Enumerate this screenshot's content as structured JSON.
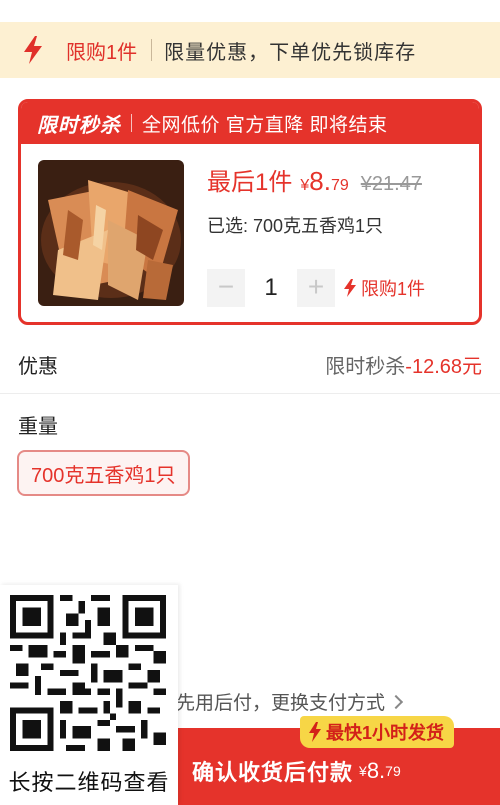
{
  "notice": {
    "limit_label": "限购1件",
    "text": "限量优惠，下单优先锁库存"
  },
  "flash_sale": {
    "title": "限时秒杀",
    "slogan": "全网低价 官方直降 即将结束",
    "last_one": "最后1件",
    "currency": "¥",
    "price_int": "8.",
    "price_dec": "79",
    "original_price": "¥21.47",
    "selected_text": "已选: 700克五香鸡1只",
    "quantity": "1",
    "minus_label": "−",
    "plus_label": "+",
    "limit_text": "限购1件"
  },
  "discount": {
    "label": "优惠",
    "name": "限时秒杀",
    "amount": "-12.68元"
  },
  "weight": {
    "label": "重量",
    "option": "700克五香鸡1只"
  },
  "payment": {
    "method_text": "先用后付，更换支付方式"
  },
  "confirm": {
    "label": "确认收货后付款",
    "currency": "¥",
    "price_int": "8.",
    "price_dec": "79"
  },
  "shipping_badge": "最快1小时发货",
  "qr": {
    "caption": "长按二维码查看"
  },
  "colors": {
    "accent_red": "#e5332b",
    "notice_bg": "#fdf0d2",
    "badge_yellow": "#f7d646"
  }
}
